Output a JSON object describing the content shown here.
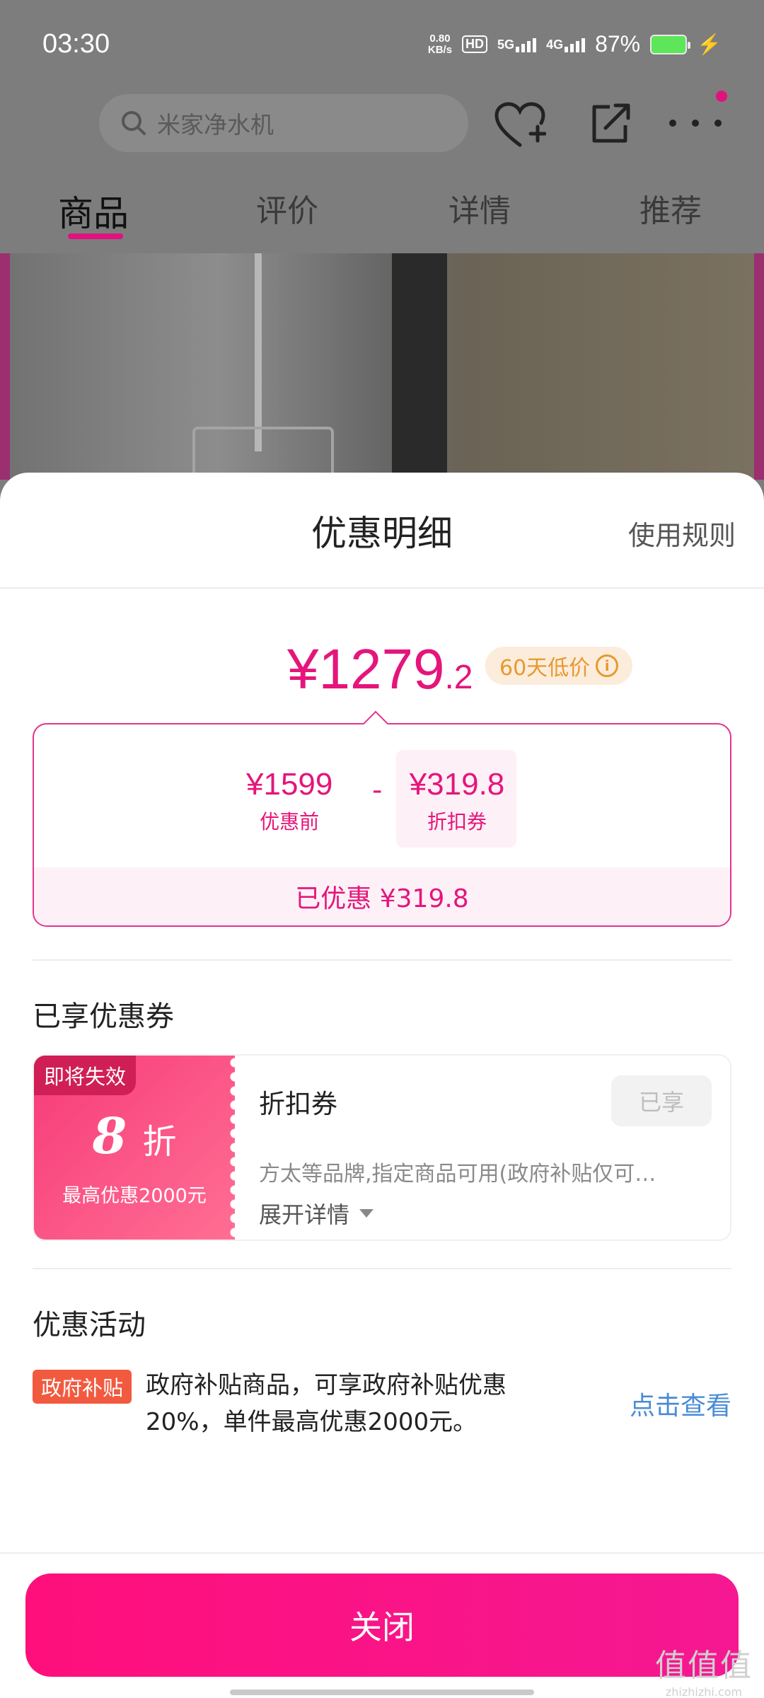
{
  "status_bar": {
    "time": "03:30",
    "net_speed": "0.80",
    "net_unit": "KB/s",
    "hd": "HD",
    "sim1": "5G",
    "sim2": "4G",
    "battery": "87%"
  },
  "nav": {
    "search_placeholder": "米家净水机"
  },
  "tabs": [
    {
      "label": "商品",
      "active": true
    },
    {
      "label": "评价"
    },
    {
      "label": "详情"
    },
    {
      "label": "推荐"
    }
  ],
  "sheet": {
    "title": "优惠明细",
    "rules": "使用规则",
    "final_price_main": "¥1279",
    "final_price_decimal": ".2",
    "low_price_tag": "60天低价",
    "info_icon_text": "i",
    "original_price": "¥1599",
    "original_label": "优惠前",
    "minus": "-",
    "coupon_amount": "¥319.8",
    "coupon_label": "折扣券",
    "saved_text": "已优惠 ¥319.8"
  },
  "coupons": {
    "section_title": "已享优惠券",
    "items": [
      {
        "expire_tag": "即将失效",
        "discount_value": "8",
        "discount_unit": "折",
        "max_text": "最高优惠2000元",
        "name": "折扣券",
        "status": "已享",
        "desc": "方太等品牌,指定商品可用(政府补贴仅可…",
        "expand": "展开详情"
      }
    ]
  },
  "activities": {
    "section_title": "优惠活动",
    "tag": "政府补贴",
    "text": "政府补贴商品，可享政府补贴优惠20%，单件最高优惠2000元。",
    "link": "点击查看"
  },
  "close_button": "关闭",
  "watermark": {
    "main": "值值值",
    "sub": "zhizhizhi.com"
  },
  "colors": {
    "accent": "#e5157b",
    "low_tag": "#e8992e",
    "link": "#4a8bd6",
    "gov_tag": "#f25a3f"
  }
}
